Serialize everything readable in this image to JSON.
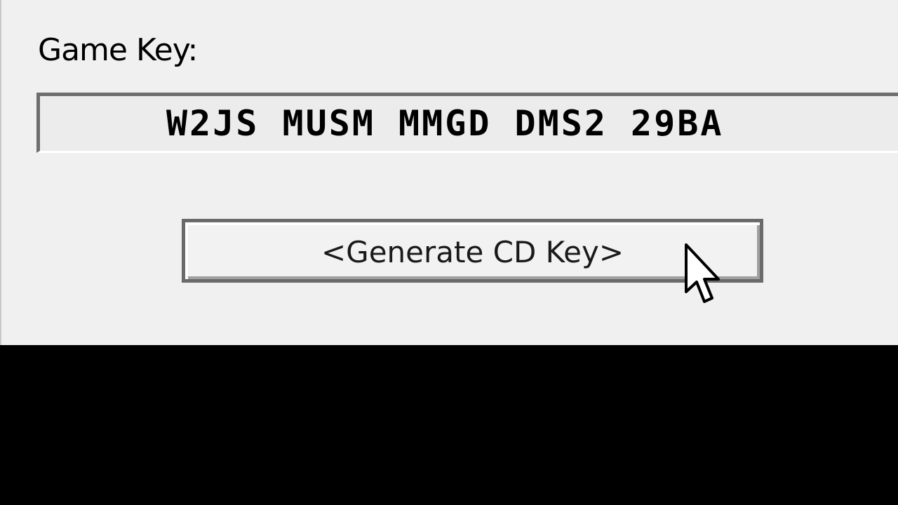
{
  "dialog": {
    "game_key_label": "Game Key:",
    "game_key_value": "W2JS MUSM MMGD DMS2 29BA",
    "generate_button_label": "<Generate CD Key>"
  },
  "icons": {
    "pointer": "mouse-pointer-icon"
  },
  "colors": {
    "dialog_bg": "#f0f0f0",
    "field_bg": "#ececec",
    "border_dark": "#6e6e6e",
    "outside_bg": "#000000"
  }
}
